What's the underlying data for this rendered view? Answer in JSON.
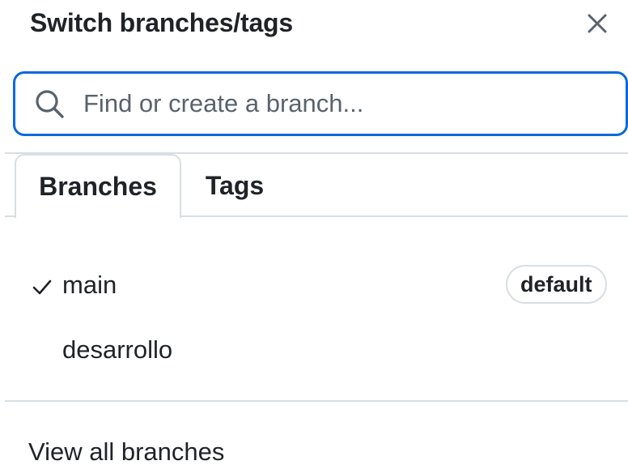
{
  "header": {
    "title": "Switch branches/tags",
    "close_icon": "close-icon"
  },
  "search": {
    "placeholder": "Find or create a branch...",
    "value": "",
    "icon": "search-icon"
  },
  "tabs": [
    {
      "label": "Branches",
      "selected": true
    },
    {
      "label": "Tags",
      "selected": false
    }
  ],
  "branches": [
    {
      "name": "main",
      "checked": true,
      "badge": "default"
    },
    {
      "name": "desarrollo",
      "checked": false,
      "badge": ""
    }
  ],
  "footer": {
    "view_all_label": "View all branches"
  },
  "colors": {
    "focus_border": "#0969da",
    "text": "#1f2328",
    "muted": "#59636e",
    "border": "#d8dee4"
  }
}
